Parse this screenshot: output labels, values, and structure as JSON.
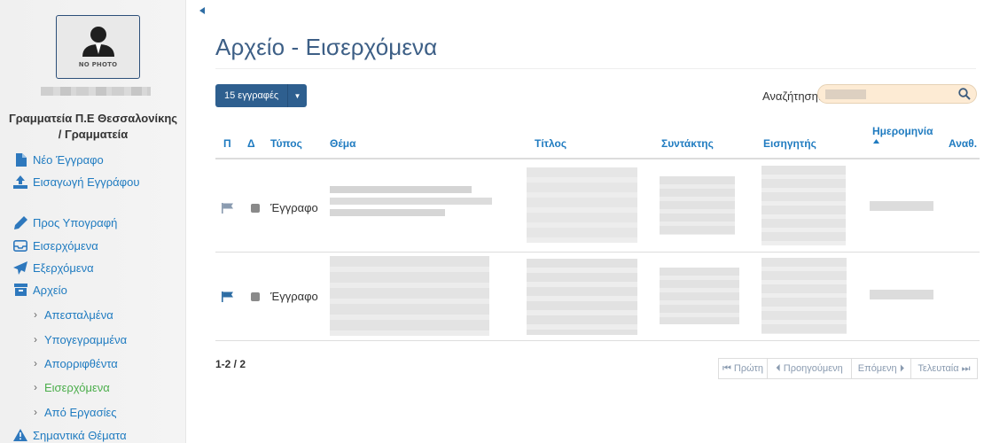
{
  "user": {
    "avatar_caption": "NO PHOTO",
    "department": "Γραμματεία Π.Ε Θεσσαλονίκης / Γραμματεία"
  },
  "sidebar": {
    "items": [
      {
        "label": "Νέο Έγγραφο",
        "icon": "file-icon"
      },
      {
        "label": "Εισαγωγή Εγγράφου",
        "icon": "upload-icon"
      },
      {
        "label": "Προς Υπογραφή",
        "icon": "pencil-icon"
      },
      {
        "label": "Εισερχόμενα",
        "icon": "inbox-icon"
      },
      {
        "label": "Εξερχόμενα",
        "icon": "send-icon"
      },
      {
        "label": "Αρχείο",
        "icon": "archive-icon"
      }
    ],
    "archive_sub": [
      {
        "label": "Απεσταλμένα"
      },
      {
        "label": "Υπογεγραμμένα"
      },
      {
        "label": "Απορριφθέντα"
      },
      {
        "label": "Εισερχόμενα"
      },
      {
        "label": "Από Εργασίες"
      }
    ],
    "important": {
      "label": "Σημαντικά Θέματα",
      "icon": "warning-icon"
    }
  },
  "main": {
    "title": "Αρχείο - Εισερχόμενα",
    "records_button": "15 εγγραφές",
    "search_label": "Αναζήτηση:",
    "search_value": ""
  },
  "table": {
    "columns": {
      "p": "Π",
      "d": "Δ",
      "type": "Τύπος",
      "subject": "Θέμα",
      "title": "Τίτλος",
      "author": "Συντάκτης",
      "rapporteur": "Εισηγητής",
      "date": "Ημερομηνία",
      "assign": "Αναθ."
    },
    "rows": [
      {
        "type": "Έγγραφο",
        "flag_color": "#8a9bb0"
      },
      {
        "type": "Έγγραφο",
        "flag_color": "#2e6da4"
      }
    ]
  },
  "pager": {
    "count": "1-2 / 2",
    "first": "⏮ Πρώτη",
    "prev": "⏴ Προηγούμενη",
    "next": "Επόμενη ⏵",
    "last": "Τελευταία ⏭"
  },
  "colors": {
    "accent": "#1f7bc0",
    "title": "#3d5f86",
    "button": "#2e5f8f",
    "active_sub": "#4cae4c"
  }
}
